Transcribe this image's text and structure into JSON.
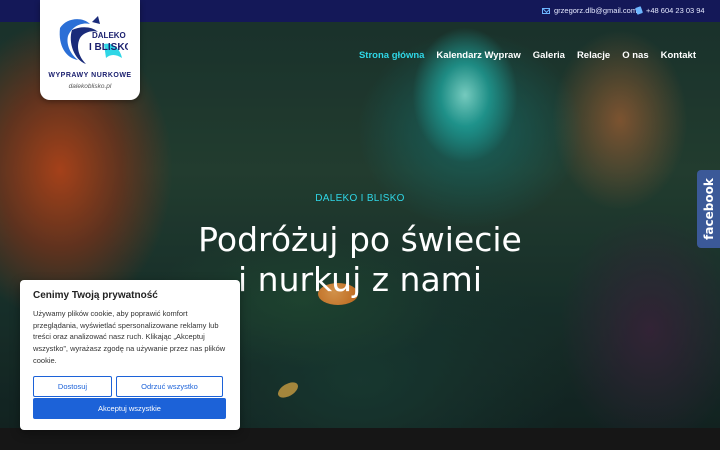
{
  "topbar": {
    "email": "grzegorz.dlb@gmail.com",
    "phone": "+48 604 23 03 94",
    "icons": [
      "mail-icon",
      "phone-icon"
    ]
  },
  "logo": {
    "brand_line1": "DALEKO",
    "brand_line2": "I BLISKO",
    "tagline": "WYPRAWY NURKOWE",
    "url": "dalekoblisko.pl"
  },
  "nav": {
    "items": [
      {
        "label": "Strona główna",
        "active": true
      },
      {
        "label": "Kalendarz Wypraw",
        "active": false
      },
      {
        "label": "Galeria",
        "active": false
      },
      {
        "label": "Relacje",
        "active": false
      },
      {
        "label": "O nas",
        "active": false
      },
      {
        "label": "Kontakt",
        "active": false
      }
    ]
  },
  "hero": {
    "eyebrow": "DALEKO I BLISKO",
    "headline_line1": "Podróżuj po świecie",
    "headline_line2": "i nurkuj z nami"
  },
  "social": {
    "facebook_label": "facebook"
  },
  "cookie_banner": {
    "title": "Cenimy Twoją prywatność",
    "body": "Używamy plików cookie, aby poprawić komfort przeglądania, wyświetlać spersonalizowane reklamy lub treści oraz analizować nasz ruch. Klikając „Akceptuj wszystko”, wyrażasz zgodę na używanie przez nas plików cookie.",
    "customize_label": "Dostosuj",
    "reject_label": "Odrzuć wszystko",
    "accept_label": "Akceptuj wszystkie"
  },
  "colors": {
    "topbar_bg": "#141858",
    "accent_cyan": "#2fd6e6",
    "button_blue": "#1c62d8",
    "facebook_blue": "#3b5998"
  }
}
